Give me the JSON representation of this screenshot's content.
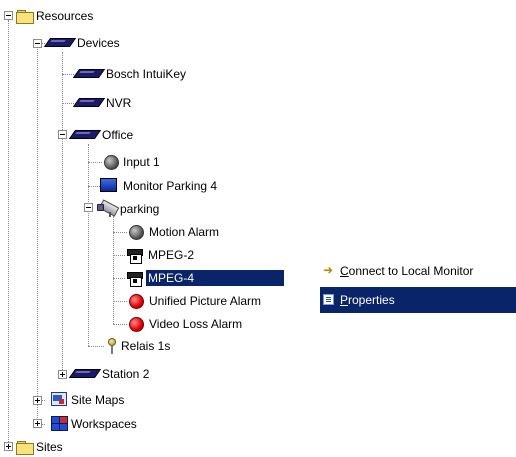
{
  "tree": {
    "resources": "Resources",
    "devices": "Devices",
    "bosch_intuikey": "Bosch IntuiKey",
    "nvr": "NVR",
    "office": "Office",
    "input_1": "Input 1",
    "monitor_parking_4": "Monitor Parking 4",
    "parking": "parking",
    "motion_alarm": "Motion Alarm",
    "mpeg_2": "MPEG-2",
    "mpeg_4": "MPEG-4",
    "unified_picture_alarm": "Unified Picture Alarm",
    "video_loss_alarm": "Video Loss Alarm",
    "relais_1s": "Relais 1s",
    "station_2": "Station 2",
    "site_maps": "Site Maps",
    "workspaces": "Workspaces",
    "sites": "Sites"
  },
  "context_menu": {
    "connect_prefix": "C",
    "connect_rest": "onnect to Local Monitor",
    "properties_prefix": "P",
    "properties_rest": "roperties"
  },
  "colors": {
    "selection": "#0a246a",
    "folder": "#fbe27a"
  }
}
